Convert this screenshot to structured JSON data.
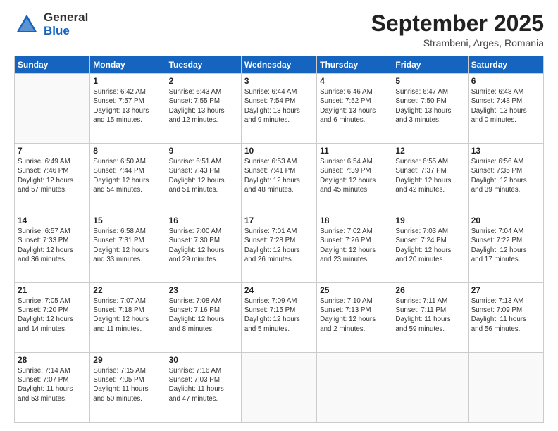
{
  "logo": {
    "general": "General",
    "blue": "Blue"
  },
  "header": {
    "month": "September 2025",
    "location": "Strambeni, Arges, Romania"
  },
  "weekdays": [
    "Sunday",
    "Monday",
    "Tuesday",
    "Wednesday",
    "Thursday",
    "Friday",
    "Saturday"
  ],
  "weeks": [
    [
      {
        "day": "",
        "info": ""
      },
      {
        "day": "1",
        "info": "Sunrise: 6:42 AM\nSunset: 7:57 PM\nDaylight: 13 hours\nand 15 minutes."
      },
      {
        "day": "2",
        "info": "Sunrise: 6:43 AM\nSunset: 7:55 PM\nDaylight: 13 hours\nand 12 minutes."
      },
      {
        "day": "3",
        "info": "Sunrise: 6:44 AM\nSunset: 7:54 PM\nDaylight: 13 hours\nand 9 minutes."
      },
      {
        "day": "4",
        "info": "Sunrise: 6:46 AM\nSunset: 7:52 PM\nDaylight: 13 hours\nand 6 minutes."
      },
      {
        "day": "5",
        "info": "Sunrise: 6:47 AM\nSunset: 7:50 PM\nDaylight: 13 hours\nand 3 minutes."
      },
      {
        "day": "6",
        "info": "Sunrise: 6:48 AM\nSunset: 7:48 PM\nDaylight: 13 hours\nand 0 minutes."
      }
    ],
    [
      {
        "day": "7",
        "info": "Sunrise: 6:49 AM\nSunset: 7:46 PM\nDaylight: 12 hours\nand 57 minutes."
      },
      {
        "day": "8",
        "info": "Sunrise: 6:50 AM\nSunset: 7:44 PM\nDaylight: 12 hours\nand 54 minutes."
      },
      {
        "day": "9",
        "info": "Sunrise: 6:51 AM\nSunset: 7:43 PM\nDaylight: 12 hours\nand 51 minutes."
      },
      {
        "day": "10",
        "info": "Sunrise: 6:53 AM\nSunset: 7:41 PM\nDaylight: 12 hours\nand 48 minutes."
      },
      {
        "day": "11",
        "info": "Sunrise: 6:54 AM\nSunset: 7:39 PM\nDaylight: 12 hours\nand 45 minutes."
      },
      {
        "day": "12",
        "info": "Sunrise: 6:55 AM\nSunset: 7:37 PM\nDaylight: 12 hours\nand 42 minutes."
      },
      {
        "day": "13",
        "info": "Sunrise: 6:56 AM\nSunset: 7:35 PM\nDaylight: 12 hours\nand 39 minutes."
      }
    ],
    [
      {
        "day": "14",
        "info": "Sunrise: 6:57 AM\nSunset: 7:33 PM\nDaylight: 12 hours\nand 36 minutes."
      },
      {
        "day": "15",
        "info": "Sunrise: 6:58 AM\nSunset: 7:31 PM\nDaylight: 12 hours\nand 33 minutes."
      },
      {
        "day": "16",
        "info": "Sunrise: 7:00 AM\nSunset: 7:30 PM\nDaylight: 12 hours\nand 29 minutes."
      },
      {
        "day": "17",
        "info": "Sunrise: 7:01 AM\nSunset: 7:28 PM\nDaylight: 12 hours\nand 26 minutes."
      },
      {
        "day": "18",
        "info": "Sunrise: 7:02 AM\nSunset: 7:26 PM\nDaylight: 12 hours\nand 23 minutes."
      },
      {
        "day": "19",
        "info": "Sunrise: 7:03 AM\nSunset: 7:24 PM\nDaylight: 12 hours\nand 20 minutes."
      },
      {
        "day": "20",
        "info": "Sunrise: 7:04 AM\nSunset: 7:22 PM\nDaylight: 12 hours\nand 17 minutes."
      }
    ],
    [
      {
        "day": "21",
        "info": "Sunrise: 7:05 AM\nSunset: 7:20 PM\nDaylight: 12 hours\nand 14 minutes."
      },
      {
        "day": "22",
        "info": "Sunrise: 7:07 AM\nSunset: 7:18 PM\nDaylight: 12 hours\nand 11 minutes."
      },
      {
        "day": "23",
        "info": "Sunrise: 7:08 AM\nSunset: 7:16 PM\nDaylight: 12 hours\nand 8 minutes."
      },
      {
        "day": "24",
        "info": "Sunrise: 7:09 AM\nSunset: 7:15 PM\nDaylight: 12 hours\nand 5 minutes."
      },
      {
        "day": "25",
        "info": "Sunrise: 7:10 AM\nSunset: 7:13 PM\nDaylight: 12 hours\nand 2 minutes."
      },
      {
        "day": "26",
        "info": "Sunrise: 7:11 AM\nSunset: 7:11 PM\nDaylight: 11 hours\nand 59 minutes."
      },
      {
        "day": "27",
        "info": "Sunrise: 7:13 AM\nSunset: 7:09 PM\nDaylight: 11 hours\nand 56 minutes."
      }
    ],
    [
      {
        "day": "28",
        "info": "Sunrise: 7:14 AM\nSunset: 7:07 PM\nDaylight: 11 hours\nand 53 minutes."
      },
      {
        "day": "29",
        "info": "Sunrise: 7:15 AM\nSunset: 7:05 PM\nDaylight: 11 hours\nand 50 minutes."
      },
      {
        "day": "30",
        "info": "Sunrise: 7:16 AM\nSunset: 7:03 PM\nDaylight: 11 hours\nand 47 minutes."
      },
      {
        "day": "",
        "info": ""
      },
      {
        "day": "",
        "info": ""
      },
      {
        "day": "",
        "info": ""
      },
      {
        "day": "",
        "info": ""
      }
    ]
  ]
}
